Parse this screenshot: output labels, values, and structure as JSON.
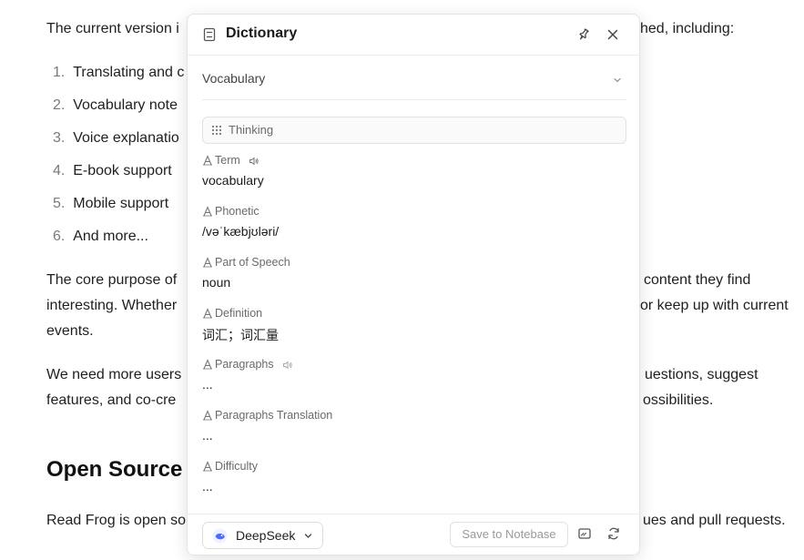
{
  "document": {
    "para1": "The current version i",
    "para1_end": "hed, including:",
    "list": [
      {
        "num": "1.",
        "text": "Translating and c"
      },
      {
        "num": "2.",
        "text": "Vocabulary note"
      },
      {
        "num": "3.",
        "text": "Voice explanatio"
      },
      {
        "num": "4.",
        "text": "E-book support"
      },
      {
        "num": "5.",
        "text": "Mobile support"
      },
      {
        "num": "6.",
        "text": "And more..."
      }
    ],
    "para2_line1": "The core purpose of",
    "para2_line1_end": "content they find",
    "para2_line2": "interesting. Whether",
    "para2_line2_end": "or keep up with current",
    "para2_line3": "events.",
    "para3_line1": "We need more users",
    "para3_line1_end": "uestions, suggest",
    "para3_line2": "features, and co-cre",
    "para3_line2_end": "ossibilities.",
    "heading": "Open Source",
    "para4": "Read Frog is open so",
    "para4_end": "ues and pull requests."
  },
  "popup": {
    "title": "Dictionary",
    "selected_mode": "Vocabulary",
    "thinking_label": "Thinking",
    "fields": [
      {
        "name": "Term",
        "value": "vocabulary",
        "speaker": true
      },
      {
        "name": "Phonetic",
        "value": "/vəˈkæbjʊləri/",
        "speaker": false
      },
      {
        "name": "Part of Speech",
        "value": "noun",
        "speaker": false
      },
      {
        "name": "Definition",
        "value": "词汇；词汇量",
        "speaker": false
      },
      {
        "name": "Paragraphs",
        "value": "...",
        "speaker": true
      },
      {
        "name": "Paragraphs Translation",
        "value": "...",
        "speaker": false
      },
      {
        "name": "Difficulty",
        "value": "...",
        "speaker": false
      }
    ],
    "footer": {
      "provider": "DeepSeek",
      "save_label": "Save to Notebase"
    }
  },
  "colors": {
    "accent_blue": "#4d6bfe",
    "text": "#1f1f1f",
    "muted": "#6a6a6a",
    "border": "#e4e4e4"
  },
  "icons": [
    "book-icon",
    "pin-icon",
    "close-icon",
    "chevron-down-icon",
    "grid-icon",
    "font-icon",
    "speaker-icon",
    "deepseek-logo-icon",
    "screen-icon",
    "refresh-icon"
  ]
}
